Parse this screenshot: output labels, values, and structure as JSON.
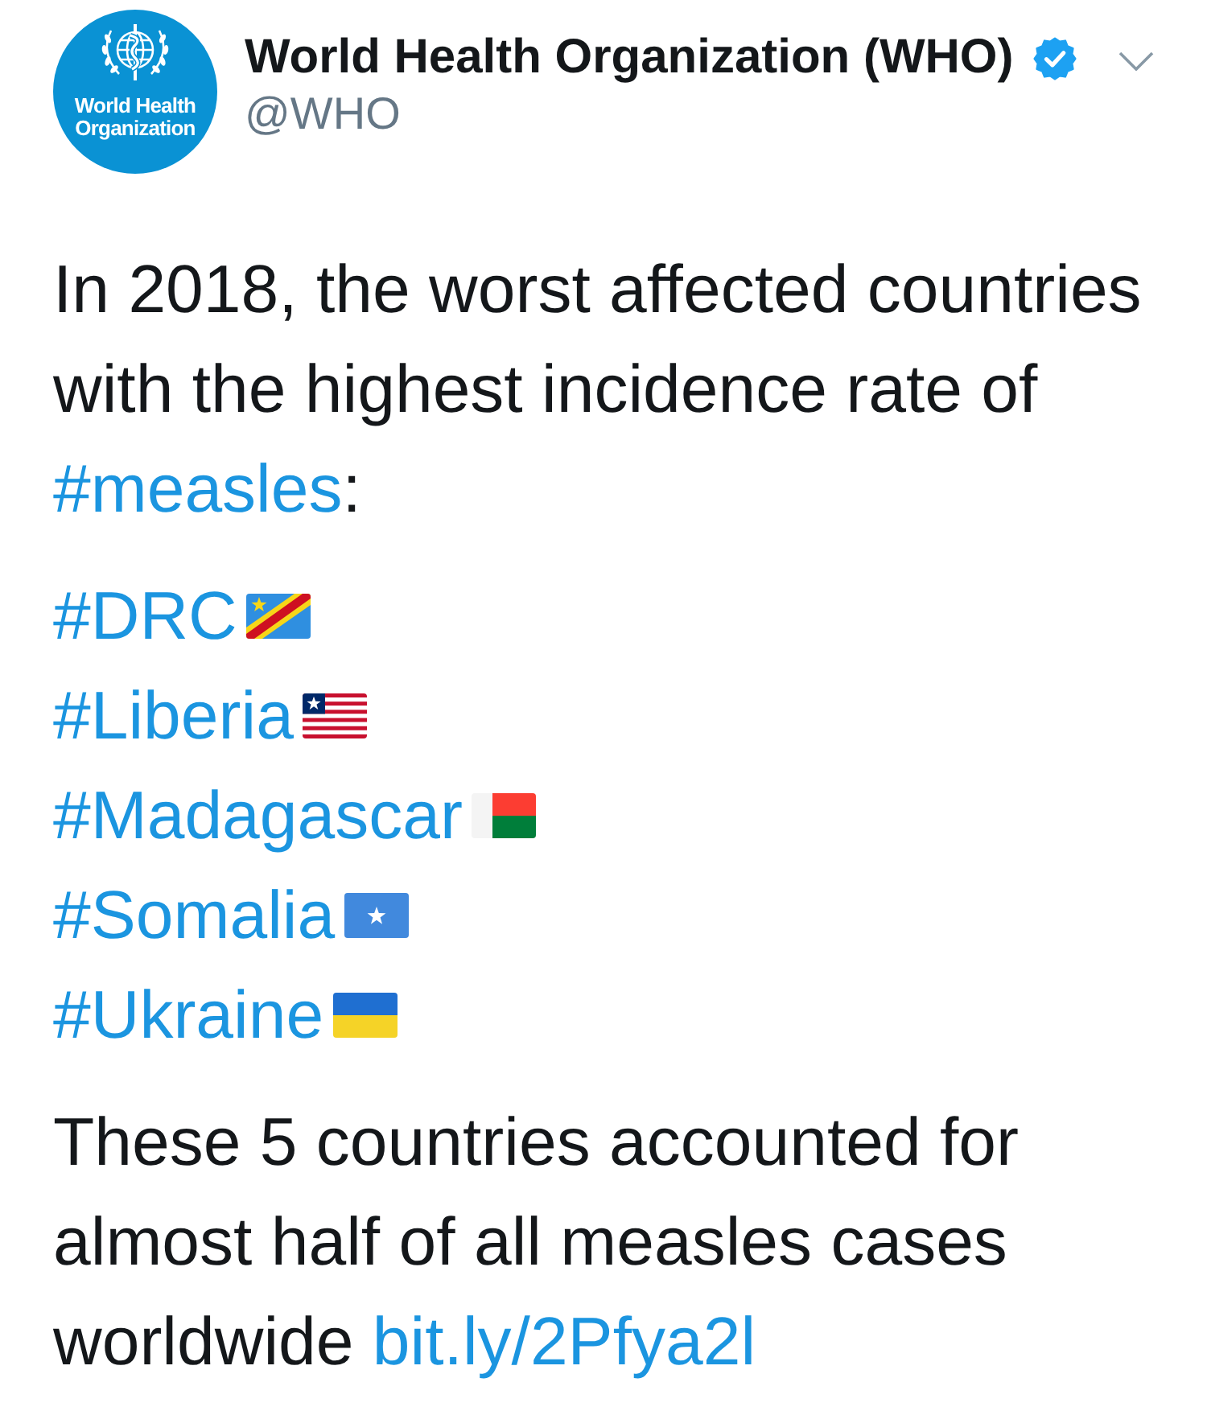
{
  "author": {
    "avatar_lines": [
      "World Health",
      "Organization"
    ],
    "name": "World Health Organization (WHO)",
    "verified": true,
    "handle": "@WHO"
  },
  "tweet": {
    "intro": [
      {
        "kind": "text",
        "text": "In 2018, the worst affected countries with the highest incidence rate of "
      },
      {
        "kind": "hashtag",
        "text": "#measles"
      },
      {
        "kind": "text",
        "text": ":"
      }
    ],
    "hashtags": [
      {
        "text": "#DRC",
        "kind": "drc"
      },
      {
        "text": "#Liberia",
        "kind": "liberia"
      },
      {
        "text": "#Madagascar",
        "kind": "madagascar"
      },
      {
        "text": "#Somalia",
        "kind": "somalia"
      },
      {
        "text": "#Ukraine",
        "kind": "ukraine"
      }
    ],
    "closing": [
      {
        "kind": "text",
        "text": "These 5 countries accounted for almost half of all measles cases worldwide "
      },
      {
        "kind": "link",
        "text": "bit.ly/2Pfya2l"
      }
    ]
  }
}
